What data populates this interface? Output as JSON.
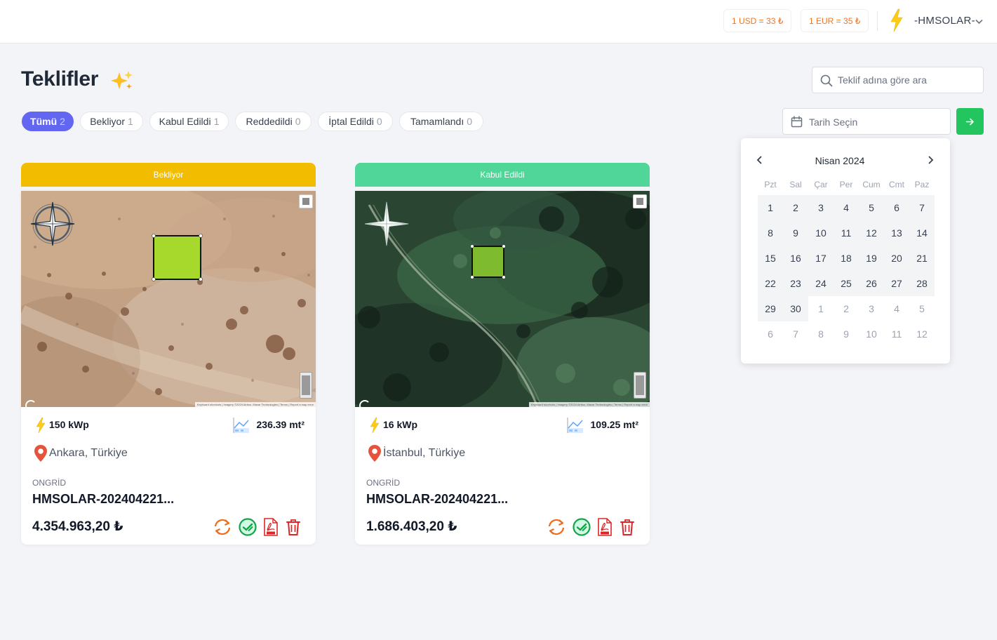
{
  "topbar": {
    "usd_rate": "1 USD = 33 ₺",
    "eur_rate": "1 EUR = 35 ₺",
    "user_name": "-HMSOLAR-"
  },
  "header": {
    "title": "Teklifler",
    "search_placeholder": "Teklif adına göre ara"
  },
  "filters": [
    {
      "label": "Tümü",
      "count": "2",
      "active": true
    },
    {
      "label": "Bekliyor",
      "count": "1"
    },
    {
      "label": "Kabul Edildi",
      "count": "1"
    },
    {
      "label": "Reddedildi",
      "count": "0"
    },
    {
      "label": "İptal Edildi",
      "count": "0"
    },
    {
      "label": "Tamamlandı",
      "count": "0"
    }
  ],
  "datepicker": {
    "placeholder": "Tarih Seçin",
    "month_label": "Nisan 2024",
    "weekdays": [
      "Pzt",
      "Sal",
      "Çar",
      "Per",
      "Cum",
      "Cmt",
      "Paz"
    ],
    "weeks": [
      [
        "1",
        "2",
        "3",
        "4",
        "5",
        "6",
        "7"
      ],
      [
        "8",
        "9",
        "10",
        "11",
        "12",
        "13",
        "14"
      ],
      [
        "15",
        "16",
        "17",
        "18",
        "19",
        "20",
        "21"
      ],
      [
        "22",
        "23",
        "24",
        "25",
        "26",
        "27",
        "28"
      ],
      [
        "29",
        "30",
        "1",
        "2",
        "3",
        "4",
        "5"
      ],
      [
        "6",
        "7",
        "8",
        "9",
        "10",
        "11",
        "12"
      ]
    ],
    "current_month_days": 30
  },
  "projects": [
    {
      "status": "Bekliyor",
      "status_color": "#f2bd00",
      "power": "150 kWp",
      "area": "236.39 mt²",
      "location": "Ankara, Türkiye",
      "type": "ONGRİD",
      "name": "HMSOLAR-202404221...",
      "price": "4.354.963,20 ₺",
      "map_style": "desert"
    },
    {
      "status": "Kabul Edildi",
      "status_color": "#4fd698",
      "power": "16 kWp",
      "area": "109.25 mt²",
      "location": "İstanbul, Türkiye",
      "type": "ONGRİD",
      "name": "HMSOLAR-202404221...",
      "price": "1.686.403,20 ₺",
      "map_style": "forest"
    }
  ],
  "map_attribution": "Keyboard shortcuts | Imagery ©2024 Airbus, Maxar Technologies | Terms | Report a map error",
  "colors": {
    "accent": "#6366f1",
    "success": "#22c55e",
    "rate_text": "#f97316",
    "bolt": "#facc15"
  },
  "icons": {
    "bolt": "lightning-bolt-icon",
    "sparkles": "sparkles-icon",
    "search": "search-icon",
    "calendar": "calendar-icon",
    "arrow": "arrow-right-icon",
    "location": "location-pin-icon",
    "area": "area-measure-icon",
    "refresh": "refresh-icon",
    "approve": "approve-icon",
    "pdf": "pdf-icon",
    "trash": "trash-icon"
  }
}
